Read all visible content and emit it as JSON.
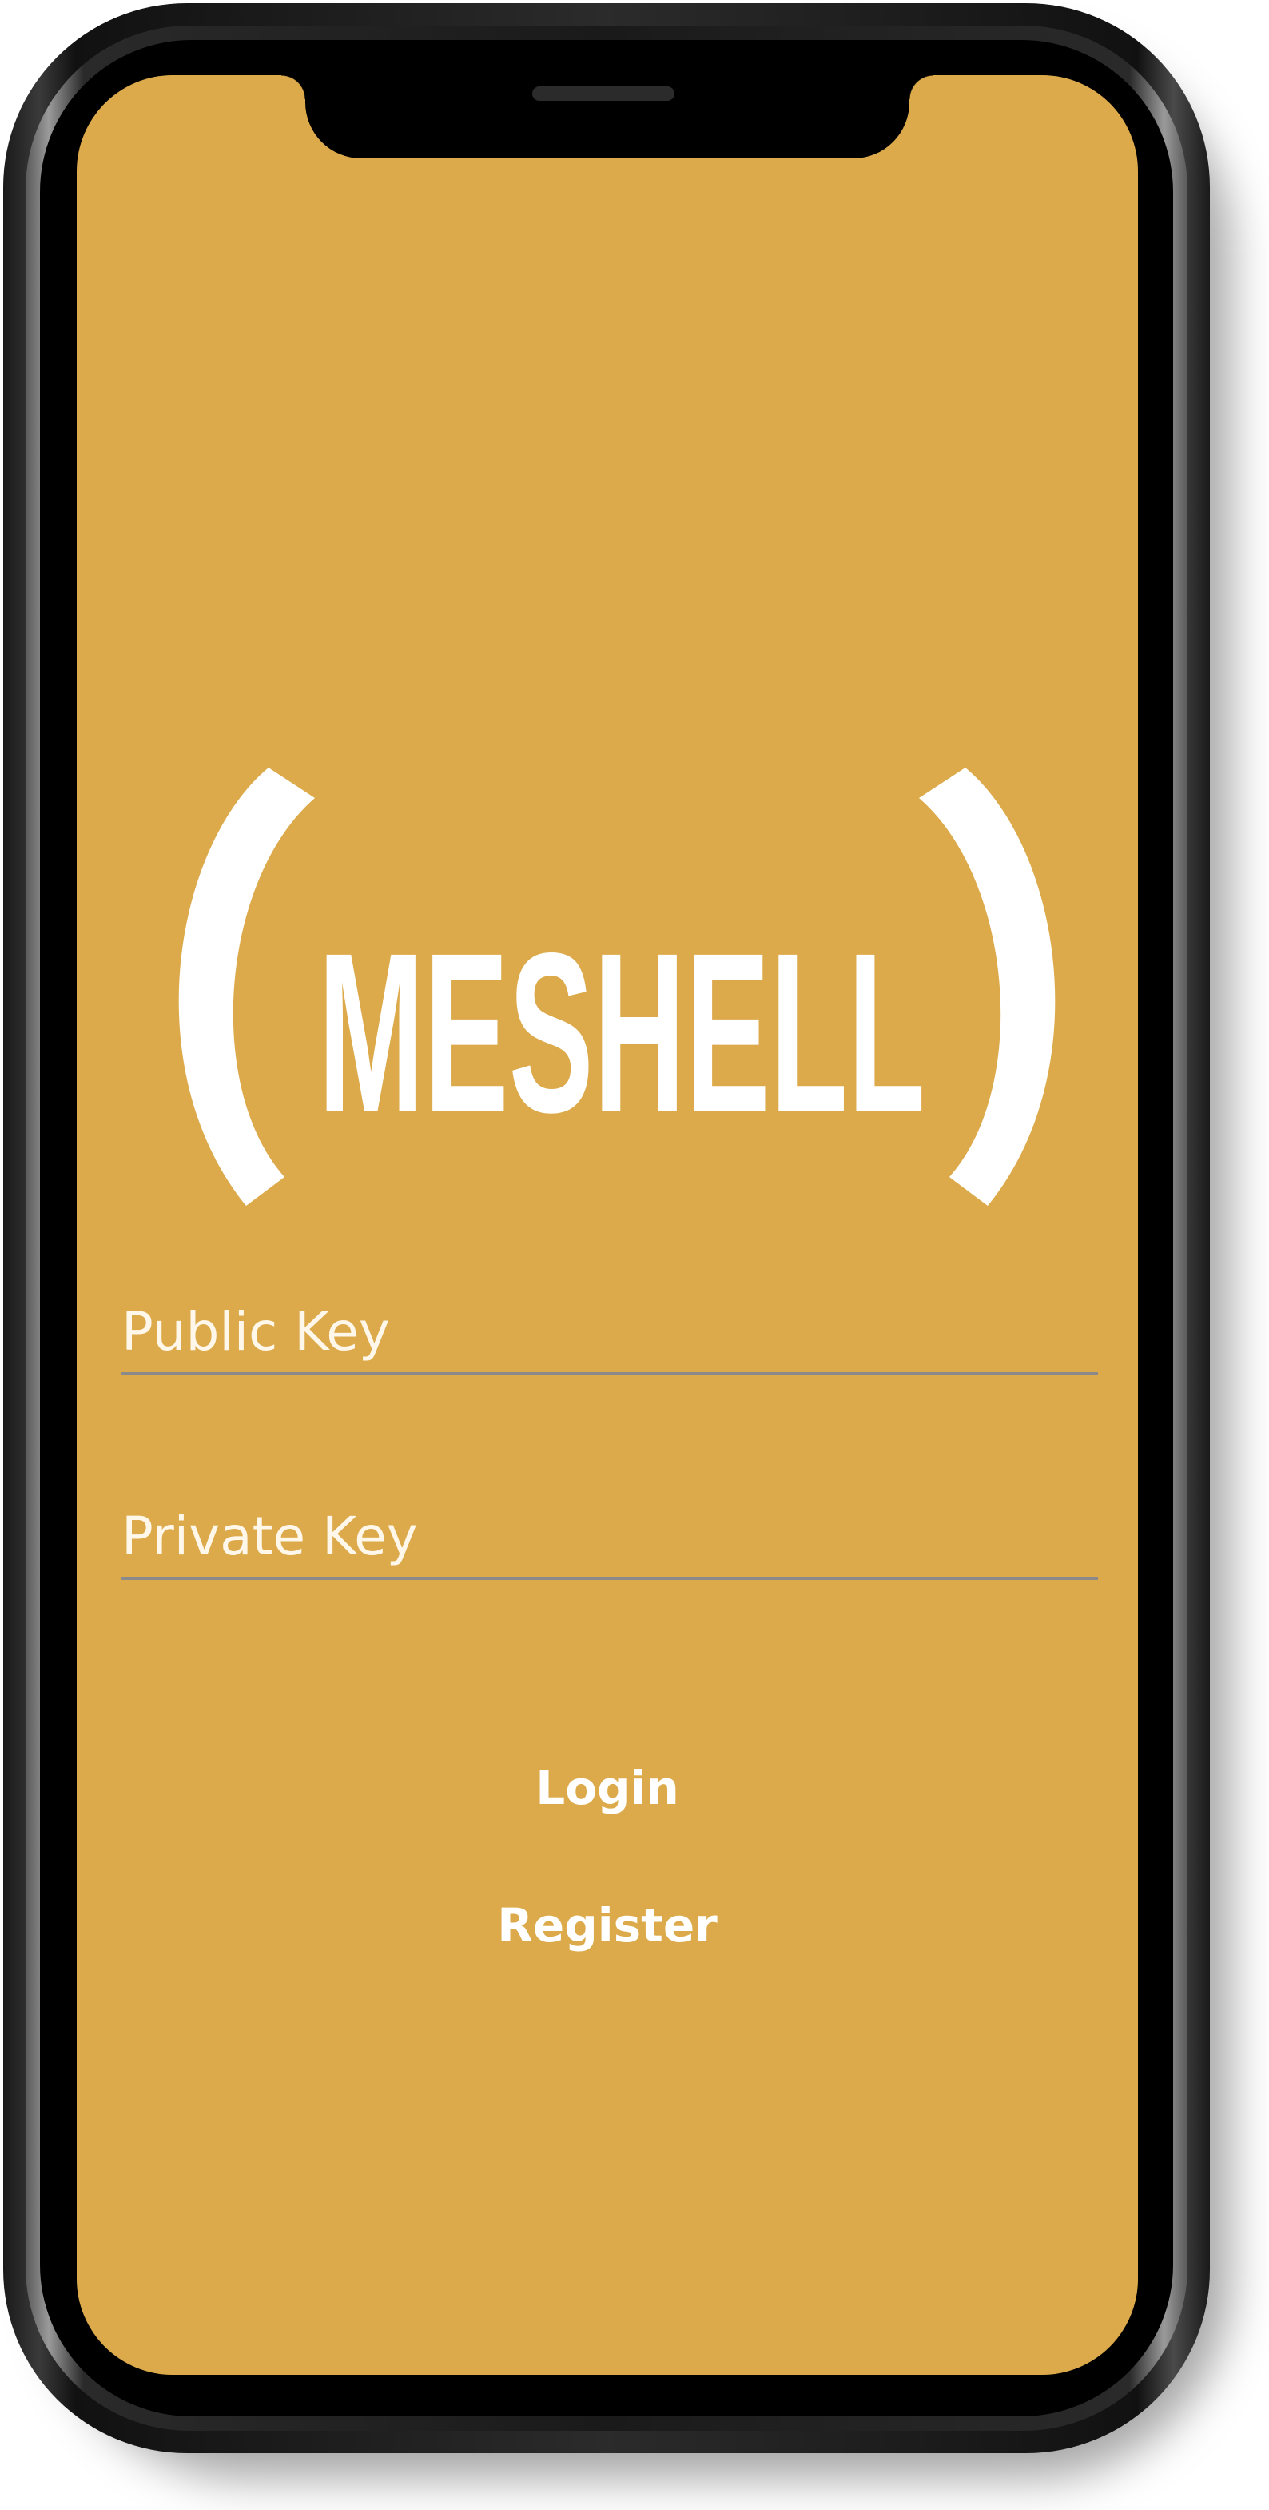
{
  "app": {
    "logo_text": "MESHELL"
  },
  "login_form": {
    "public_key_placeholder": "Public Key",
    "private_key_placeholder": "Private Key",
    "login_label": "Login",
    "register_label": "Register"
  },
  "colors": {
    "screen_background": "#dcaa4a",
    "text": "#ffffff",
    "underline": "#8a8a8a"
  }
}
